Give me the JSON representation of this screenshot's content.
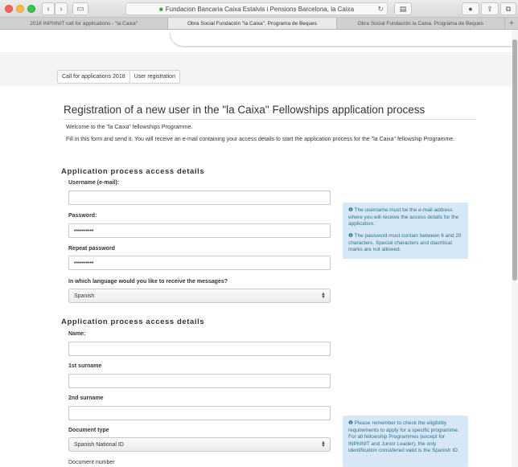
{
  "browser": {
    "url": "Fundacion Bancaria Caixa Estalvis i Pensions Barcelona, la Caixa",
    "tabs": [
      {
        "label": "2018 INPhINIT call for applications - \"la Caixa\""
      },
      {
        "label": "Obra Social Fundación \"la Caixa\". Programa de Beques"
      },
      {
        "label": "Obra Social Fundación la Caixa. Programa de Beques"
      }
    ],
    "new_tab": "+"
  },
  "breadcrumb": {
    "items": [
      "Call for applications 2018",
      "User registration"
    ]
  },
  "page": {
    "title": "Registration of a new user in the \"la Caixa\" Fellowships application process",
    "welcome": "Welcome  to the \"la Caixa\" fellowships Programme.",
    "instructions": "Fill in this form and send it. You will receive an e-mail containing your access details to start the application process for the \"la Caixa\" fellowship Programme."
  },
  "section1": {
    "heading": "Application process access details",
    "username_label": "Username (e-mail):",
    "username_value": "",
    "password_label": "Password:",
    "password_value": "••••••••••",
    "repeat_label": "Repeat password",
    "repeat_value": "••••••••••",
    "language_label": "In which language would you like to receive the messages?",
    "language_value": "Spanish",
    "info_username": "The username must be the e-mail address where you will receive the access details for the application.",
    "info_password": "The password must contain between 6 and 20 characters. Special characters and diacritical marks are not allowed."
  },
  "section2": {
    "heading": "Application process access details",
    "name_label": "Name:",
    "surname1_label": "1st surname",
    "surname2_label": "2nd surname",
    "doctype_label": "Document type",
    "doctype_value": "Spanish National ID",
    "docnum_label": "Document number",
    "info_document": "Please remember to check the eligibility requirements to apply for a specific programme. For all fellowship Programmes (except for INPhINIT and Junior Leader), the only identification considered valid is the Spanish ID."
  },
  "icons": {
    "info": "info-circle-icon",
    "lock": "lock-icon"
  }
}
